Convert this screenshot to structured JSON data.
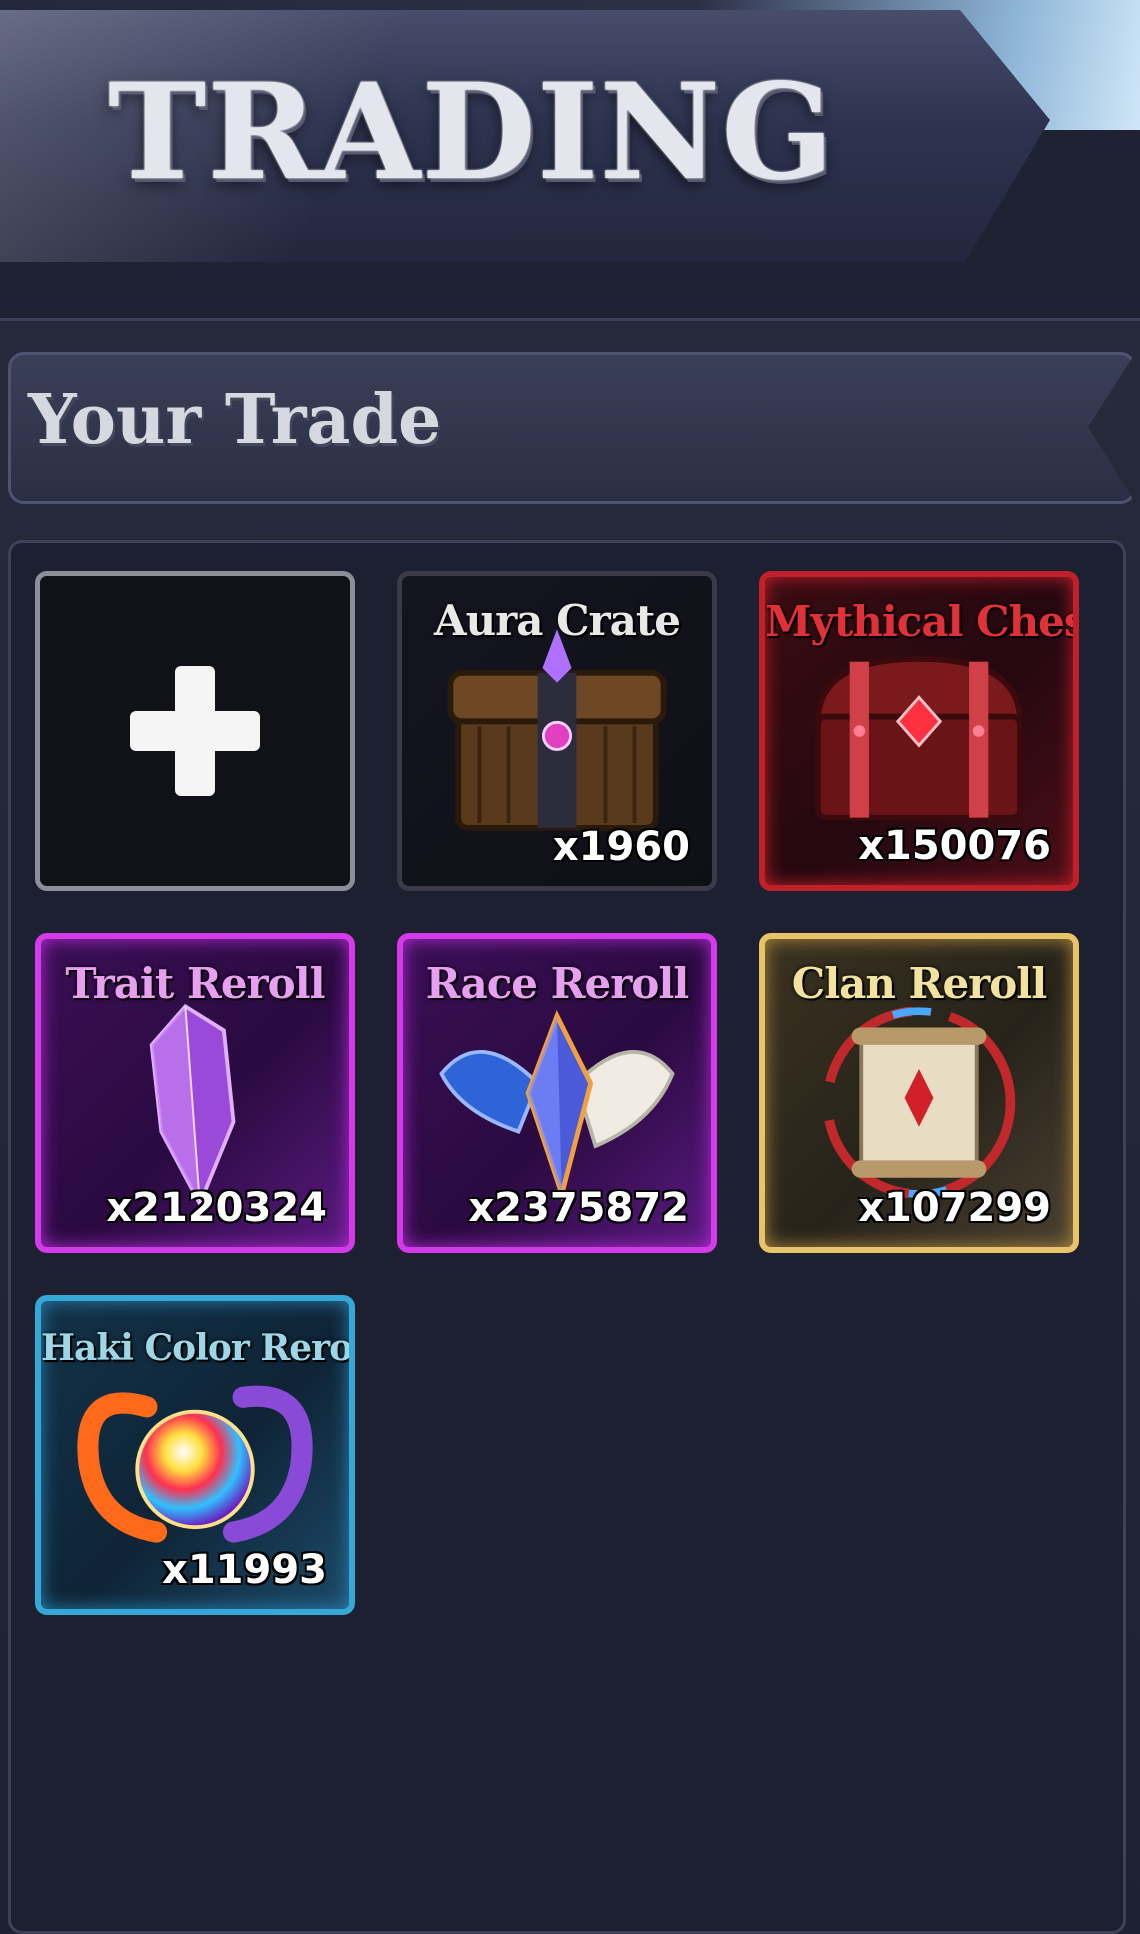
{
  "header": {
    "title": "TRADING"
  },
  "trade": {
    "title": "Your Trade",
    "add_slot": {
      "icon": "plus-icon"
    },
    "items": [
      {
        "name": "Aura Crate",
        "count": "x1960",
        "rarity_color": "#3a3a48",
        "icon": "chest-icon"
      },
      {
        "name": "Mythical Chest",
        "count": "x150076",
        "rarity_color": "#c0202a",
        "icon": "chest-icon"
      },
      {
        "name": "Trait Reroll",
        "count": "x2120324",
        "rarity_color": "#d33ae8",
        "icon": "crystal-icon"
      },
      {
        "name": "Race Reroll",
        "count": "x2375872",
        "rarity_color": "#d33ae8",
        "icon": "winged-gem-icon"
      },
      {
        "name": "Clan Reroll",
        "count": "x107299",
        "rarity_color": "#e7c46a",
        "icon": "scroll-icon"
      },
      {
        "name": "Haki Color Reroll",
        "count": "x11993",
        "rarity_color": "#36a8d8",
        "icon": "rainbow-orb-icon"
      }
    ]
  }
}
